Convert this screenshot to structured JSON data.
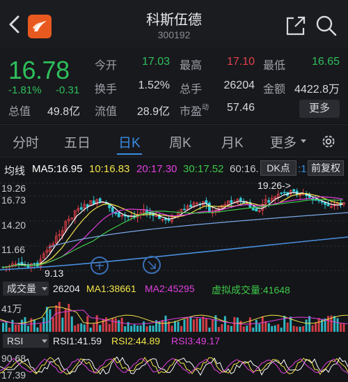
{
  "header": {
    "name": "科斯伍德",
    "code": "300192"
  },
  "quote": {
    "price": "16.78",
    "change_pct": "-1.81%",
    "change_abs": "-0.31",
    "mktcap_label": "总值",
    "mktcap_value": "49.8亿",
    "fields": [
      {
        "label": "今开",
        "value": "17.03",
        "color": "#2fbf5b"
      },
      {
        "label": "最高",
        "value": "17.10",
        "color": "#e5414b"
      },
      {
        "label": "最低",
        "value": "16.65",
        "color": "#2fbf5b"
      },
      {
        "label": "换手",
        "value": "1.52%",
        "color": "#d7d9de"
      },
      {
        "label": "总手",
        "value": "26204",
        "color": "#d7d9de"
      },
      {
        "label": "金额",
        "value": "4422.8万",
        "color": "#d7d9de"
      },
      {
        "label": "流值",
        "value": "28.9亿",
        "color": "#d7d9de"
      },
      {
        "label": "市盈",
        "sup": "动",
        "value": "57.46",
        "color": "#d7d9de"
      }
    ],
    "more_label": "更多"
  },
  "tabs": [
    "分时",
    "五日",
    "日K",
    "周K",
    "月K",
    "更多"
  ],
  "active_tab": "日K",
  "ma_row": {
    "label": "均线",
    "ma5": "MA5:16.95",
    "ma10": "10:16.83",
    "ma20": "20:17.30",
    "ma30": "30:17.52",
    "ma60": "60:16.",
    "dk_label": "DK点",
    "adjust_label": "前复权"
  },
  "kline": {
    "y_labels": [
      "19.26",
      "16.73",
      "14.20",
      "11.66",
      "9.13"
    ],
    "high_marker": "19.26->",
    "low_marker": "9.13"
  },
  "volume": {
    "selector": "成交量",
    "value": "26204",
    "ma1": "MA1:38661",
    "ma2": "MA2:45295",
    "virtual": "虚拟成交量:41648",
    "y_label": "41万"
  },
  "rsi": {
    "selector": "RSI",
    "rsi1": "RSI1:41.59",
    "rsi2": "RSI2:44.89",
    "rsi3": "RSI3:49.17",
    "y_top": "90.68",
    "y_bottom": "17.39"
  },
  "colors": {
    "up": "#e5414b",
    "down": "#2fbf5b",
    "cyan": "#33c9d6",
    "accent": "#3a8ee6",
    "ma5": "#ffffff",
    "ma10": "#f2e54a",
    "ma20": "#e040e0",
    "ma30": "#3ec94a",
    "ma60": "#c7c9ce"
  }
}
